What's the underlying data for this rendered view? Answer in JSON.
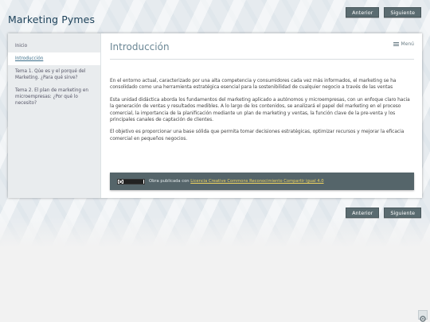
{
  "header": {
    "site_title": "Marketing Pymes",
    "prev_label": "Anterior",
    "next_label": "Siguiente"
  },
  "sidebar": {
    "items": [
      {
        "label": "Inicio",
        "active": false
      },
      {
        "label": "Introducción",
        "active": true
      },
      {
        "label": "Tema 1. Qúe es y el porqué del Marketing. ¿Para qué sirve?",
        "active": false
      },
      {
        "label": "Tema 2. El plan de marketing en microempresas: ¿Por qué lo necesito?",
        "active": false
      }
    ]
  },
  "main": {
    "title": "Introducción",
    "menu_label": "Menú",
    "paragraphs": [
      "En el entorno actual, caracterizado por una alta competencia y consumidores cada vez más informados, el marketing se ha consolidado como una herramienta estratégica esencial para la sostenibilidad de cualquier negocio a través de las ventas",
      "Esta unidad didáctica aborda los fundamentos del marketing aplicado a autónomos y microempresas, con un enfoque claro hacia la generación de ventas y resultados medibles. A lo largo de los contenidos, se analizará el papel del marketing en el proceso comercial, la importancia de la planificación mediante un plan de marketing y ventas, la función clave de la pre-venta y los principales canales de captación de clientes.",
      "El objetivo es proporcionar una base sólida que permita tomar decisiones estratégicas, optimizar recursos y mejorar la eficacia comercial en pequeños negocios."
    ],
    "license": {
      "prefix": "Obra publicada con ",
      "link_text": "Licencia Creative Commons Reconocimiento Compartir igual 4.0",
      "badge_text": "cc by sa"
    }
  },
  "footer": {
    "prev_label": "Anterior",
    "next_label": "Siguiente"
  },
  "colors": {
    "title": "#20445c",
    "button_bg": "#5a6b70",
    "license_bg": "#55656a",
    "link": "#f1d560"
  }
}
